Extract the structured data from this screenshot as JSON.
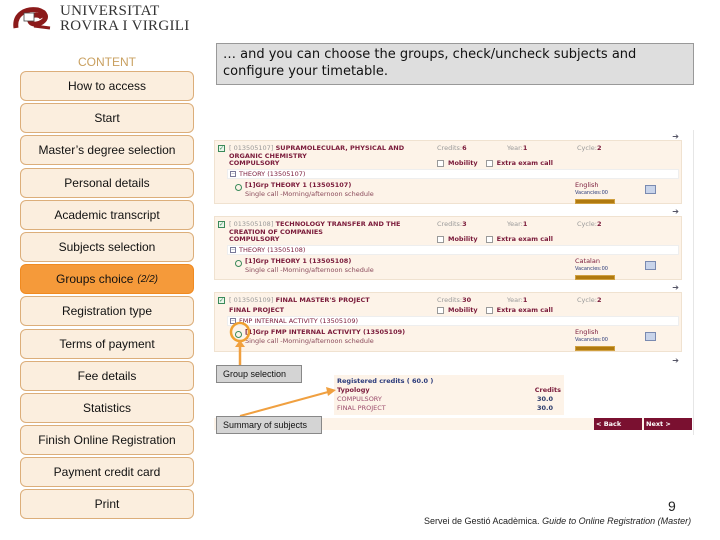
{
  "logo": {
    "line1": "UNIVERSITAT",
    "line2": "ROVIRA I VIRGILI",
    "brand_color": "#8b1a1a"
  },
  "sidebar": {
    "heading": "CONTENT",
    "items": [
      {
        "label": "How to access",
        "active": false
      },
      {
        "label": "Start",
        "active": false
      },
      {
        "label": "Master’s degree selection",
        "active": false
      },
      {
        "label": "Personal details",
        "active": false
      },
      {
        "label": "Academic transcript",
        "active": false
      },
      {
        "label": "Subjects selection",
        "active": false
      },
      {
        "label": "Groups choice",
        "sub": "(2/2)",
        "active": true
      },
      {
        "label": "Registration type",
        "active": false
      },
      {
        "label": "Terms of payment",
        "active": false
      },
      {
        "label": "Fee details",
        "active": false
      },
      {
        "label": "Statistics",
        "active": false
      },
      {
        "label": "Finish Online Registration",
        "active": false
      },
      {
        "label": "Payment credit card",
        "active": false
      },
      {
        "label": "Print",
        "active": false
      }
    ],
    "active_color": "#f59a3a"
  },
  "caption": "… and you can choose the groups, check/uncheck subjects and configure your timetable.",
  "subjects": [
    {
      "code": "[ 013505107]",
      "title": "SUPRAMOLECULAR, PHYSICAL AND ORGANIC CHEMISTRY",
      "credits_label": "Credits:",
      "credits": "6",
      "year_label": "Year:",
      "year": "1",
      "cycle_label": "Cycle:",
      "cycle": "2",
      "typology": "COMPULSORY",
      "mobility": "Mobility",
      "extra": "Extra exam call",
      "activity": "THEORY (13505107)",
      "group": "[1]Grp THEORY 1 (13505107)",
      "schedule": "Single call -Morning/afternoon schedule",
      "language": "English",
      "vacancies": "Vacancies:00"
    },
    {
      "code": "[ 013505108]",
      "title": "TECHNOLOGY TRANSFER AND THE CREATION OF COMPANIES",
      "credits_label": "Credits:",
      "credits": "3",
      "year_label": "Year:",
      "year": "1",
      "cycle_label": "Cycle:",
      "cycle": "2",
      "typology": "COMPULSORY",
      "mobility": "Mobility",
      "extra": "Extra exam call",
      "activity": "THEORY (13505108)",
      "group": "[1]Grp THEORY 1 (13505108)",
      "schedule": "Single call -Morning/afternoon schedule",
      "language": "Catalan",
      "vacancies": "Vacancies:00"
    },
    {
      "code": "[ 013505109]",
      "title": "FINAL MASTER'S PROJECT",
      "credits_label": "Credits:",
      "credits": "30",
      "year_label": "Year:",
      "year": "1",
      "cycle_label": "Cycle:",
      "cycle": "2",
      "typology": "FINAL PROJECT",
      "mobility": "Mobility",
      "extra": "Extra exam call",
      "activity": "FMP INTERNAL ACTIVITY (13505109)",
      "group": "[1]Grp FMP INTERNAL ACTIVITY (13505109)",
      "schedule": "Single call -Morning/afternoon schedule",
      "language": "English",
      "vacancies": "Vacancies:00"
    }
  ],
  "summary": {
    "title": "Registered credits ( 60.0 )",
    "col_typology": "Typology",
    "col_credits": "Credits",
    "rows": [
      {
        "typology": "COMPULSORY",
        "credits": "30.0"
      },
      {
        "typology": "FINAL PROJECT",
        "credits": "30.0"
      }
    ]
  },
  "buttons": {
    "back": "< Back",
    "next": "Next >"
  },
  "annotations": {
    "group_selection": "Group selection",
    "summary_of_subjects": "Summary of subjects",
    "color": "#f0a040"
  },
  "footer": {
    "page": "9",
    "org": "Servei de Gestió Acadèmica.",
    "doc": "Guide to Online Registration (Master)"
  }
}
